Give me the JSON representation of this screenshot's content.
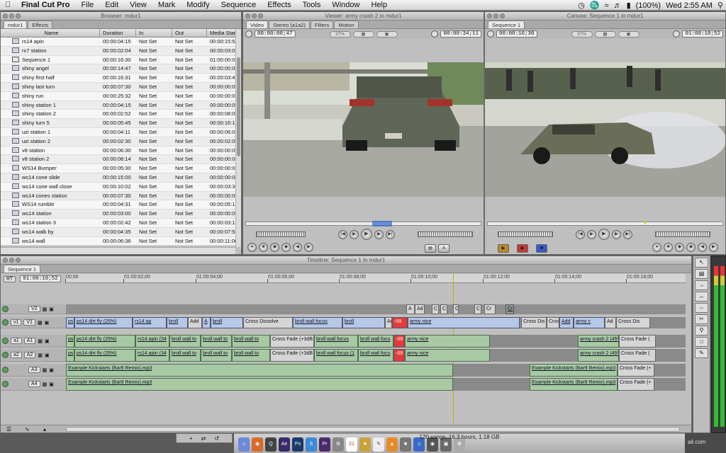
{
  "menubar": {
    "apple": "",
    "app": "Final Cut Pro",
    "items": [
      "File",
      "Edit",
      "View",
      "Mark",
      "Modify",
      "Sequence",
      "Effects",
      "Tools",
      "Window",
      "Help"
    ],
    "battery": "(100%)",
    "clock": "Wed 2:55 AM"
  },
  "browser": {
    "title": "Browser: mdur1",
    "tabs": [
      "mdur1",
      "Effects"
    ],
    "columns": [
      "Name",
      "Duration",
      "In",
      "Out",
      "Media Start"
    ],
    "rows": [
      [
        "rs14 apin",
        "00:00:04:15",
        "Not Set",
        "Not Set",
        "00:00:15:54"
      ],
      [
        "rx7 station",
        "00:00:02:04",
        "Not Set",
        "Not Set",
        "00:00:03:00"
      ],
      [
        "Sequence 1",
        "00:00:16:30",
        "Not Set",
        "Not Set",
        "01:00:00:00"
      ],
      [
        "shiny angel",
        "00:00:14:47",
        "Not Set",
        "Not Set",
        "00:00:00:00"
      ],
      [
        "shiny first half",
        "00:00:16:31",
        "Not Set",
        "Not Set",
        "00:00:03:4"
      ],
      [
        "shiny last turn",
        "00:00:07:30",
        "Not Set",
        "Not Set",
        "00:00:00:00"
      ],
      [
        "shiny run",
        "00:00:25:32",
        "Not Set",
        "Not Set",
        "00:00:00:00"
      ],
      [
        "shiny station 1",
        "00:00:04:15",
        "Not Set",
        "Not Set",
        "00:00:00:00"
      ],
      [
        "shiny station 2",
        "00:00:02:52",
        "Not Set",
        "Not Set",
        "00:00:08:00"
      ],
      [
        "shiny turn 5",
        "00:00:05:45",
        "Not Set",
        "Not Set",
        "00:00:16:18"
      ],
      [
        "uzi station 1",
        "00:00:04:11",
        "Not Set",
        "Not Set",
        "00:00:06:00"
      ],
      [
        "uzi station 2",
        "00:00:02:30",
        "Not Set",
        "Not Set",
        "00:00:02:00"
      ],
      [
        "v8 station",
        "00:00:06:30",
        "Not Set",
        "Not Set",
        "00:00:00:00"
      ],
      [
        "v8 station 2",
        "00:00:08:14",
        "Not Set",
        "Not Set",
        "00:00:00:00"
      ],
      [
        "WS14 Bumper",
        "00:00:05:30",
        "Not Set",
        "Not Set",
        "00:00:00:00"
      ],
      [
        "ws14 cone slide",
        "00:00:15:00",
        "Not Set",
        "Not Set",
        "00:00:00:00"
      ],
      [
        "ws14 cone wall close",
        "00:00:10:02",
        "Not Set",
        "Not Set",
        "00:00:03:30"
      ],
      [
        "ws14 cones station",
        "00:00:07:30",
        "Not Set",
        "Not Set",
        "00:00:00:00"
      ],
      [
        "WS14 rumble",
        "00:00:04:31",
        "Not Set",
        "Not Set",
        "00:00:05:14"
      ],
      [
        "ws14 station",
        "00:00:03:00",
        "Not Set",
        "Not Set",
        "00:00:00:00"
      ],
      [
        "ws14 station 3",
        "00:00:02:42",
        "Not Set",
        "Not Set",
        "00:00:03:18"
      ],
      [
        "ws14 walk by",
        "00:00:04:35",
        "Not Set",
        "Not Set",
        "00:00:07:50"
      ],
      [
        "ws14 wall",
        "00:00:06:36",
        "Not Set",
        "Not Set",
        "00:00:11:00"
      ]
    ],
    "sequence_row": 2
  },
  "viewer": {
    "title": "Viewer: army crash 2 in mdur1",
    "tabs": [
      "Video",
      "Stereo (a1a2)",
      "Filters",
      "Motion"
    ],
    "tc_duration": "00:00:00;47",
    "zoom": "37%",
    "tc_current": "00:00:34;11"
  },
  "canvas": {
    "title": "Canvas: Sequence 1 in mdur1",
    "tabs": [
      "Sequence 1"
    ],
    "tc_duration": "00:00:16;30",
    "zoom": "37%",
    "tc_current": "01:00:10;52"
  },
  "timeline": {
    "title": "Timeline: Sequence 1 in mdur1",
    "tab": "Sequence 1",
    "rt": "RT",
    "tc": "01:00:10;52",
    "ruler": [
      "00;00",
      "01:00:02;00",
      "01:00:04;00",
      "01:00:06;00",
      "01:00:08;00",
      "01:00:10;00",
      "01:00:12;00",
      "01:00:14;00",
      "01:00:16;00"
    ],
    "tracks": {
      "v2": "V2",
      "v1a": "v1",
      "v1b": "V1",
      "a1a": "a1",
      "a1b": "A1",
      "a2a": "a2",
      "a2b": "A2",
      "a3": "A3",
      "a4": "A4"
    },
    "v1_clips": [
      "ps",
      "ps14 dirt fly (25%)",
      "rs14 ap",
      "broll",
      "Add",
      "A",
      "broll",
      "Cross Dissolve",
      "broll wall focus",
      "broll",
      "Ad",
      "-09",
      "army nice",
      "Cross Dis",
      "Cros",
      "Add",
      "army c",
      "Ad",
      "Cross Dis"
    ],
    "v2_clips": [
      "A",
      "Ad",
      "C",
      "C",
      "C",
      "C",
      "Cr",
      "Cr"
    ],
    "a1_clips": [
      "ps",
      "ps14 dirt fly (25%)",
      "rs14 apin (34",
      "broll wall to",
      "broll wall to",
      "broll wall to",
      "Cross Fade (+3dB",
      "broll wall focus",
      "broll wall focu",
      "-09",
      "army nice",
      "army crash 2 (45%",
      "Cross Fade ("
    ],
    "a2_clips": [
      "ps",
      "ps14 dirt fly (25%)",
      "rs14 apin (34",
      "broll wall to",
      "broll wall to",
      "broll wall to",
      "Cross Fade (+3dB",
      "broll wall focus (1",
      "broll wall focu",
      "-09",
      "army nice",
      "army crash 2 (45%",
      "Cross Fade ("
    ],
    "a3_clips": [
      "Example  Kickstarts (Bar9 Remix).mp3",
      "Example  Kickstarts (Bar9 Remix).mp3",
      "Cross Fade (+"
    ],
    "a4_clips": [
      "Example  Kickstarts (Bar9 Remix).mp3",
      "Example  Kickstarts (Bar9 Remix).mp3",
      "Cross Fade (+"
    ]
  },
  "dock": {
    "info": "120 songs, 16.3 hours, 1.18 GB",
    "icons": [
      "Ae",
      "Ps",
      "S",
      "Pr",
      "21"
    ],
    "right_text": "ail.com"
  },
  "colors": {
    "video_clip": "#b6c8e6",
    "audio_clip": "#a7c9a4",
    "panel": "#bfbfbf",
    "accent_red": "#e23b3b"
  }
}
